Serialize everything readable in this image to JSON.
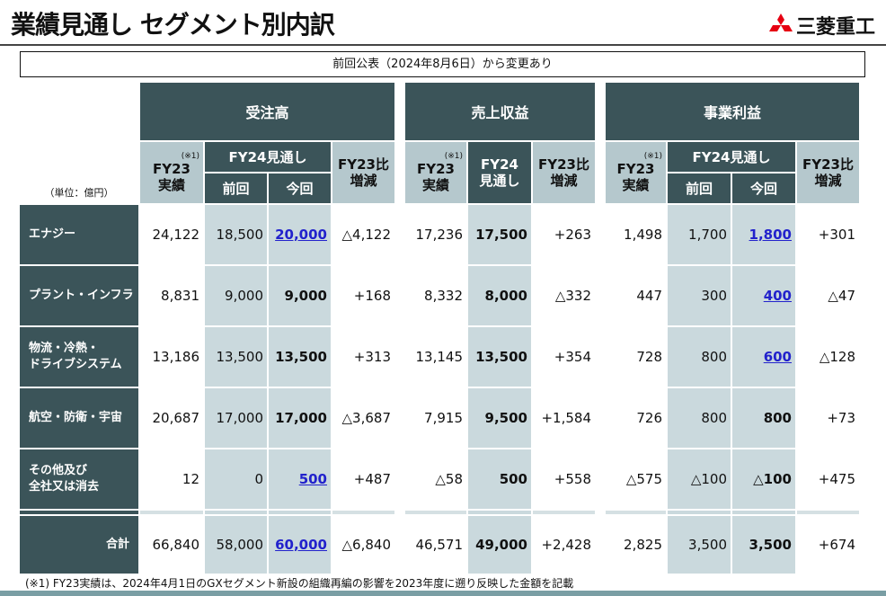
{
  "title": "業績見通し セグメント別内訳",
  "logo": "三菱重工",
  "notice": "前回公表（2024年8月6日）から変更あり",
  "unit": "（単位：億円）",
  "groups": {
    "orders": "受注高",
    "revenue": "売上収益",
    "profit": "事業利益"
  },
  "sub": {
    "fy23": "FY23",
    "fy23_2": "実績",
    "note": "(※1)",
    "fy24": "FY24見通し",
    "fy24a": "FY24",
    "fy24b": "見通し",
    "prev": "前回",
    "curr": "今回",
    "diff1": "FY23比",
    "diff2": "増減"
  },
  "rows": [
    {
      "label": "エナジー",
      "o": [
        "24,122",
        "18,500",
        "20,000",
        "△4,122"
      ],
      "r": [
        "17,236",
        "17,500",
        "+263"
      ],
      "p": [
        "1,498",
        "1,700",
        "1,800",
        "+301"
      ],
      "oc": true,
      "pc": true
    },
    {
      "label": "プラント・インフラ",
      "o": [
        "8,831",
        "9,000",
        "9,000",
        "+168"
      ],
      "r": [
        "8,332",
        "8,000",
        "△332"
      ],
      "p": [
        "447",
        "300",
        "400",
        "△47"
      ],
      "oc": false,
      "pc": true
    },
    {
      "label": "物流・冷熱・\nドライブシステム",
      "o": [
        "13,186",
        "13,500",
        "13,500",
        "+313"
      ],
      "r": [
        "13,145",
        "13,500",
        "+354"
      ],
      "p": [
        "728",
        "800",
        "600",
        "△128"
      ],
      "oc": false,
      "pc": true
    },
    {
      "label": "航空・防衛・宇宙",
      "o": [
        "20,687",
        "17,000",
        "17,000",
        "△3,687"
      ],
      "r": [
        "7,915",
        "9,500",
        "+1,584"
      ],
      "p": [
        "726",
        "800",
        "800",
        "+73"
      ],
      "oc": false,
      "pc": false
    },
    {
      "label": "その他及び\n全社又は消去",
      "o": [
        "12",
        "0",
        "500",
        "+487"
      ],
      "r": [
        "△58",
        "500",
        "+558"
      ],
      "p": [
        "△575",
        "△100",
        "△100",
        "+475"
      ],
      "oc": true,
      "pc": false
    },
    {
      "label": "合計",
      "o": [
        "66,840",
        "58,000",
        "60,000",
        "△6,840"
      ],
      "r": [
        "46,571",
        "49,000",
        "+2,428"
      ],
      "p": [
        "2,825",
        "3,500",
        "3,500",
        "+674"
      ],
      "oc": true,
      "pc": false,
      "total": true
    }
  ],
  "footnote": "(※1) FY23実績は、2024年4月1日のGXセグメント新設の組織再編の影響を2023年度に遡り反映した金額を記載",
  "colors": {
    "dark": "#3b5459",
    "light": "#cad9dd",
    "header_light": "#b5c8cd",
    "link": "#2222cc"
  }
}
